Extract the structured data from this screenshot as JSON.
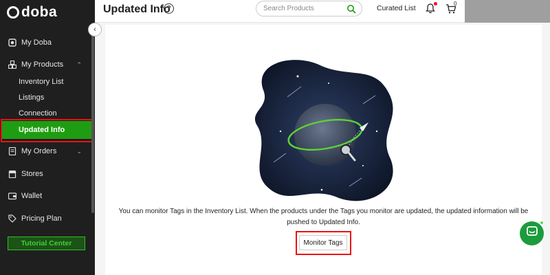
{
  "app": {
    "brand": "doba"
  },
  "sidebar": {
    "items": [
      {
        "label": "My Doba",
        "icon": "dashboard-icon"
      },
      {
        "label": "My Products",
        "icon": "boxes-icon",
        "expanded": true
      },
      {
        "label": "My Orders",
        "icon": "orders-icon",
        "expanded": false
      },
      {
        "label": "Stores",
        "icon": "store-icon"
      },
      {
        "label": "Wallet",
        "icon": "wallet-icon"
      },
      {
        "label": "Pricing Plan",
        "icon": "tag-icon"
      }
    ],
    "sub_items": [
      {
        "label": "Inventory List"
      },
      {
        "label": "Listings"
      },
      {
        "label": "Connection"
      },
      {
        "label": "Updated Info",
        "active": true
      }
    ],
    "tutorial_label": "Tutorial Center"
  },
  "header": {
    "title": "Updated Info",
    "help_glyph": "?",
    "search_placeholder": "Search Products",
    "curated_label": "Curated List",
    "cart_count": "0"
  },
  "main": {
    "info_text": "You can monitor Tags in the Inventory List. When the products under the Tags you monitor are updated, the updated information will be pushed to Updated Info.",
    "monitor_button": "Monitor Tags"
  },
  "colors": {
    "sidebar_bg": "#1f1f1f",
    "accent_green": "#1f9d12",
    "highlight_red": "#e11111",
    "chat_green": "#1c9c3c"
  }
}
